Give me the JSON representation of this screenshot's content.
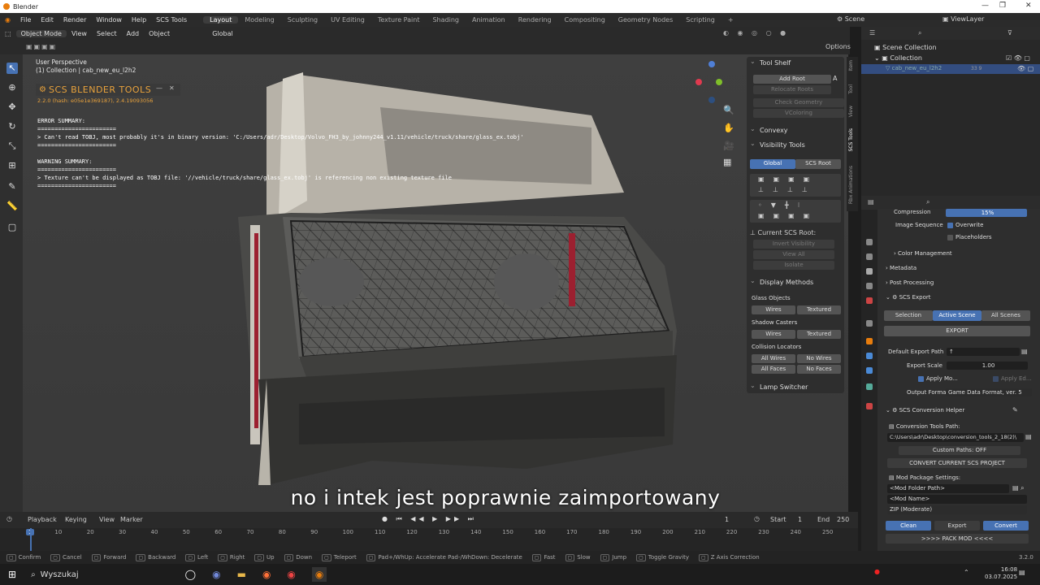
{
  "window": {
    "title": "Blender"
  },
  "menu": {
    "items": [
      "File",
      "Edit",
      "Render",
      "Window",
      "Help",
      "SCS Tools"
    ],
    "workspaces": [
      "Layout",
      "Modeling",
      "Sculpting",
      "UV Editing",
      "Texture Paint",
      "Shading",
      "Animation",
      "Rendering",
      "Compositing",
      "Geometry Nodes",
      "Scripting"
    ],
    "scene": "Scene",
    "viewlayer": "ViewLayer"
  },
  "viewport_header": {
    "mode": "Object Mode",
    "view": "View",
    "select": "Select",
    "add": "Add",
    "object": "Object",
    "orientation": "Global",
    "options": "Options"
  },
  "overlay": {
    "perspective": "User Perspective",
    "collection": "(1) Collection | cab_new_eu_l2h2"
  },
  "scs_tools": {
    "title": "SCS BLENDER TOOLS",
    "version": "2.2.0 (hash: e05e1e369187), 2.4.19093056",
    "error_title": "ERROR SUMMARY:",
    "sep": "=======================",
    "error_msg": "> Can't read TOBJ, most probably it's in binary version: 'C:/Users/adr/Desktop/Volvo_FH3_by_johnny244_v1.11/vehicle/truck/share/glass_ex.tobj'",
    "warning_title": "WARNING SUMMARY:",
    "warning_msg": "> Texture can't be displayed as TOBJ file: '//vehicle/truck/share/glass_ex.tobj' is referencing non existing texture file"
  },
  "npanel": {
    "tool_shelf": "Tool Shelf",
    "add_root": "Add Root",
    "relocate_roots": "Relocate Roots",
    "check_geometry": "Check Geometry",
    "vcoloring": "VColoring",
    "convexy": "Convexy",
    "visibility_tools": "Visibility Tools",
    "global": "Global",
    "scs_root": "SCS Root",
    "current_scs_root": "Current SCS Root:",
    "invert_visibility": "Invert Visibility",
    "view_all": "View All",
    "isolate": "Isolate",
    "display_methods": "Display Methods",
    "glass_objects": "Glass Objects",
    "shadow_casters": "Shadow Casters",
    "wires": "Wires",
    "textured": "Textured",
    "collision_locators": "Collision Locators",
    "all_wires": "All Wires",
    "no_wires": "No Wires",
    "all_faces": "All Faces",
    "no_faces": "No Faces",
    "lamp_switcher": "Lamp Switcher"
  },
  "side_tabs": [
    "Item",
    "Tool",
    "View",
    "SCS Tools",
    "Rbx Animations"
  ],
  "outliner": {
    "scene_collection": "Scene Collection",
    "collection": "Collection",
    "object": "cab_new_eu_l2h2",
    "count": "33 9"
  },
  "properties": {
    "compression_label": "Compression",
    "compression_value": "15%",
    "image_sequence": "Image Sequence",
    "overwrite": "Overwrite",
    "placeholders": "Placeholders",
    "color_management": "Color Management",
    "metadata": "Metadata",
    "post_processing": "Post Processing",
    "scs_export": "SCS Export",
    "selection": "Selection",
    "active_scene": "Active Scene",
    "all_scenes": "All Scenes",
    "export": "EXPORT",
    "default_export_path": "Default Export Path",
    "export_scale_label": "Export Scale",
    "export_scale": "1.00",
    "apply_mo": "Apply Mo...",
    "apply_ed": "Apply Ed...",
    "output_format_label": "Output Format:",
    "output_format": "Game Data Format, ver. 5",
    "conversion_helper": "SCS Conversion Helper",
    "conversion_tools_path": "Conversion Tools Path:",
    "conversion_path_value": "C:\\Users\\adr\\Desktop\\conversion_tools_2_18(2)\\",
    "custom_paths": "Custom Paths: OFF",
    "convert_current": "CONVERT CURRENT SCS PROJECT",
    "mod_package": "Mod Package Settings:",
    "mod_folder": "<Mod Folder Path>",
    "mod_name": "<Mod Name>",
    "zip": "ZIP (Moderate)",
    "clean": "Clean",
    "export_btn": "Export",
    "convert": "Convert",
    "pack_mod": ">>>>   PACK MOD   <<<<"
  },
  "timeline": {
    "playback": "Playback",
    "keying": "Keying",
    "view": "View",
    "marker": "Marker",
    "current": "1",
    "start_label": "Start",
    "start": "1",
    "end_label": "End",
    "end": "250",
    "ticks": [
      "1",
      "10",
      "20",
      "30",
      "40",
      "50",
      "60",
      "70",
      "80",
      "90",
      "100",
      "110",
      "120",
      "130",
      "140",
      "150",
      "160",
      "170",
      "180",
      "190",
      "200",
      "210",
      "220",
      "230",
      "240",
      "250"
    ]
  },
  "status": [
    "Confirm",
    "Cancel",
    "Forward",
    "Backward",
    "Left",
    "Right",
    "Up",
    "Down",
    "Teleport",
    "Pad+/WhUp: Accelerate Pad-/WhDown: Decelerate",
    "Fast",
    "Slow",
    "Jump",
    "Toggle Gravity",
    "Z Axis Correction"
  ],
  "status_version": "3.2.0",
  "subtitle": "no i intek jest poprawnie zaimportowany",
  "taskbar": {
    "search": "Wyszukaj",
    "time": "16:08",
    "date": "03.07.2025"
  }
}
